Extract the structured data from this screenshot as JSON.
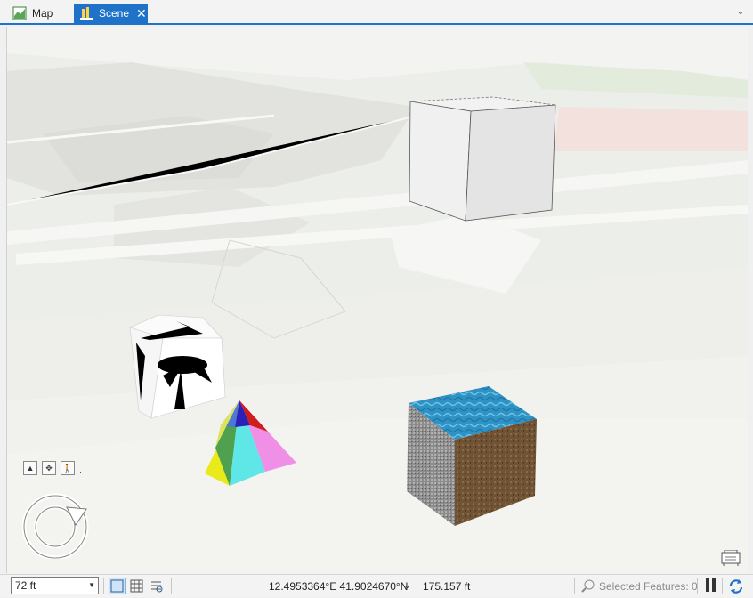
{
  "tabs": [
    {
      "label": "Map",
      "icon": "map-icon",
      "active": false
    },
    {
      "label": "Scene",
      "icon": "scene-icon",
      "active": true,
      "closable": true
    }
  ],
  "status_bar": {
    "scale": "72 ft",
    "coordinates": "12.4953364°E 41.9024670°N",
    "elevation": "175.157 ft",
    "selected_features": "Selected Features: 0"
  },
  "colors": {
    "accent": "#1e73c8",
    "ground": "#eceeea",
    "water_top": "#2f92c4",
    "soil_side": "#7a5a3a"
  }
}
